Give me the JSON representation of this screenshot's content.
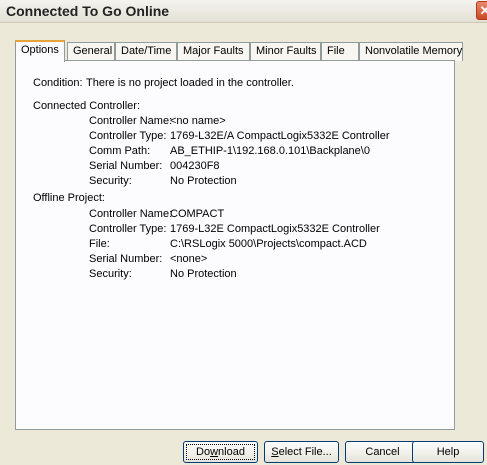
{
  "window": {
    "title": "Connected To Go Online",
    "close_glyph": "✕"
  },
  "tabs": [
    "Options",
    "General",
    "Date/Time",
    "Major Faults",
    "Minor Faults",
    "File",
    "Nonvolatile Memory"
  ],
  "condition": {
    "label": "Condition:",
    "value": "There is no project loaded in the controller."
  },
  "connected": {
    "heading": "Connected Controller:",
    "rows": [
      {
        "label": "Controller Name:",
        "value": "<no name>"
      },
      {
        "label": "Controller Type:",
        "value": "1769-L32E/A CompactLogix5332E Controller"
      },
      {
        "label": "Comm Path:",
        "value": "AB_ETHIP-1\\192.168.0.101\\Backplane\\0"
      },
      {
        "label": "Serial Number:",
        "value": "004230F8"
      },
      {
        "label": "Security:",
        "value": "No Protection"
      }
    ]
  },
  "offline": {
    "heading": "Offline Project:",
    "rows": [
      {
        "label": "Controller Name:",
        "value": "COMPACT"
      },
      {
        "label": "Controller Type:",
        "value": "1769-L32E CompactLogix5332E Controller"
      },
      {
        "label": "File:",
        "value": "C:\\RSLogix 5000\\Projects\\compact.ACD"
      },
      {
        "label": "Serial Number:",
        "value": "<none>"
      },
      {
        "label": "Security:",
        "value": "No Protection"
      }
    ]
  },
  "buttons": {
    "download": {
      "pre": "Do",
      "mnemonic": "w",
      "post": "nload"
    },
    "select_file": {
      "pre": "",
      "mnemonic": "S",
      "post": "elect File..."
    },
    "cancel": "Cancel",
    "help": "Help"
  }
}
